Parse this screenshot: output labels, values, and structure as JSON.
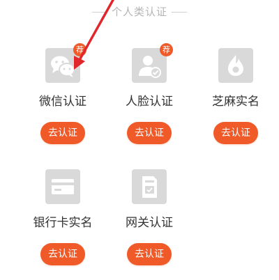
{
  "section": {
    "title": "个人类认证"
  },
  "badge_label": "荐",
  "items": [
    {
      "label": "微信认证",
      "button": "去认证",
      "icon": "wechat-icon",
      "badge": true
    },
    {
      "label": "人脸认证",
      "button": "去认证",
      "icon": "face-verify-icon",
      "badge": true
    },
    {
      "label": "芝麻实名",
      "button": "去认证",
      "icon": "sesame-icon",
      "badge": false
    },
    {
      "label": "银行卡实名",
      "button": "去认证",
      "icon": "bank-card-icon",
      "badge": false
    },
    {
      "label": "网关认证",
      "button": "去认证",
      "icon": "sim-card-icon",
      "badge": false
    }
  ],
  "colors": {
    "accent": "#f05a28",
    "icon_bg": "#d9d9d9",
    "arrow": "#e0262a"
  }
}
